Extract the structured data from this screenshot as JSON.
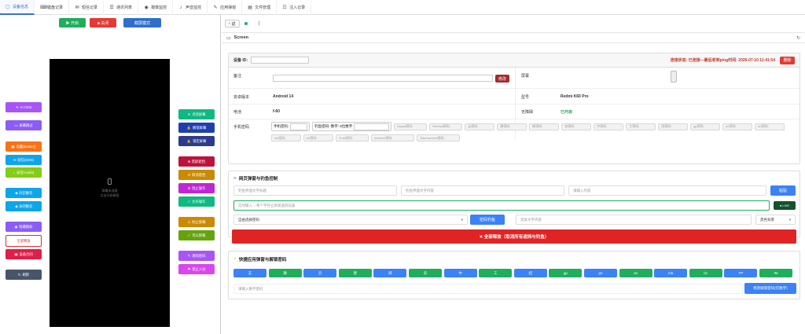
{
  "tabs": [
    {
      "icon": "▢",
      "label": "设备信息"
    },
    {
      "icon": "⌨",
      "label": "键盘记录"
    },
    {
      "icon": "✉",
      "label": "短信记录"
    },
    {
      "icon": "☰",
      "label": "通讯列表"
    },
    {
      "icon": "◉",
      "label": "摄像监控"
    },
    {
      "icon": "♪",
      "label": "声音监控"
    },
    {
      "icon": "✎",
      "label": "应用弹窗"
    },
    {
      "icon": "▤",
      "label": "文件管理"
    },
    {
      "icon": "☷",
      "label": "注入记录"
    }
  ],
  "left": {
    "start": "▶ 开启",
    "close": "■ 关闭",
    "screenshot_mode": "截屏模式",
    "phone_line1": "屏幕未连接",
    "phone_line2": "点击开启按钮",
    "buttons_col1": [
      "AI Chat",
      "屏幕跳过",
      "电量(Battery)",
      "短信(SMS)",
      "录音(Audio)",
      "开启静音",
      "关闭静音",
      "隐藏图标",
      "全部释放",
      "设备合同",
      "刷新"
    ],
    "buttons_col2": [
      "点亮屏幕",
      "解锁屏幕",
      "锁定屏幕",
      "黑屏遮挡",
      "取消遮挡",
      "阻止操作",
      "允许操作",
      "防止卸载",
      "可以卸载",
      "清除密码",
      "禁止入驻"
    ]
  },
  "right": {
    "back": "返",
    "cursor": "|",
    "screen_title": "Screen",
    "device_id_label": "设备 ID:",
    "device_id_value": "",
    "connection_status": "连接状态: 已连接—最后收到ping时间: 2026-07-10 11:41:54",
    "delete_btn": "删除",
    "remark_label": "备注",
    "modify_btn": "修改",
    "screen_label": "屏幕",
    "android_label": "安卓版本",
    "android_value": "Android 14",
    "model_label": "型号",
    "model_value": "Redmi K60 Pro",
    "battery_label": "电池",
    "battery_value": "f-60",
    "accessibility_label": "无障碍",
    "accessibility_value": "已开启",
    "phone_pwd_label": "手机密码",
    "pwd_fields": [
      {
        "label": "手机密码:",
        "value": ""
      },
      {
        "label": "钓鱼密码: 数字: 6位数字",
        "value": ""
      }
    ],
    "pwd_pills_row1": [
      "Alipay密码:",
      "Wechat密码:",
      "云密码:",
      "建密码:",
      "邮密码:",
      "农密码:",
      "中密码:",
      "工密码:",
      "招密码:",
      "gp密码:",
      "pe密码:",
      "an密码:"
    ],
    "pwd_pills_row2": [
      "mb密码:",
      "bc密码:",
      "Trust密码:",
      "Imtoken密码:",
      "Tokenpocket密码:"
    ],
    "phishing_title": "网页弹窗与钓鱼控制",
    "ph_title_ph": "钓鱼界面文字标题",
    "ph_content_ph": "钓鱼界面文字内容",
    "ph_input_ph": "请输入内容",
    "paste_btn": "粘贴",
    "live_ph": "实时输入 – 每个字符立即发送到设备",
    "live_btn": "● LIVE",
    "auto_select": "自由选择密码",
    "pwd_fish_btn": "密码钓鱼",
    "bg_text_ph": "黑屏文字内容",
    "bg_select": "黑色背景",
    "release_all": "✕ 全部释放（取消所有遮挡与钓鱼）",
    "quick_title": "快捷应用弹窗与解锁密码",
    "quick_chips": [
      "支",
      "微",
      "云",
      "建",
      "邮",
      "农",
      "中",
      "工",
      "招",
      "gp",
      "pe",
      "an",
      "mb",
      "bc",
      "TP",
      "IM"
    ],
    "unlock_ph": "请输入数字密码",
    "unlock_btn": "修改解锁密码(仅数字)"
  },
  "colors": {
    "blue": "#3b82f6",
    "green": "#1fae5b",
    "red": "#e53935",
    "purple": "#a855f7",
    "orange": "#f97316",
    "yellow": "#eab308",
    "navy": "#2e3a8c",
    "gray": "#475569"
  }
}
